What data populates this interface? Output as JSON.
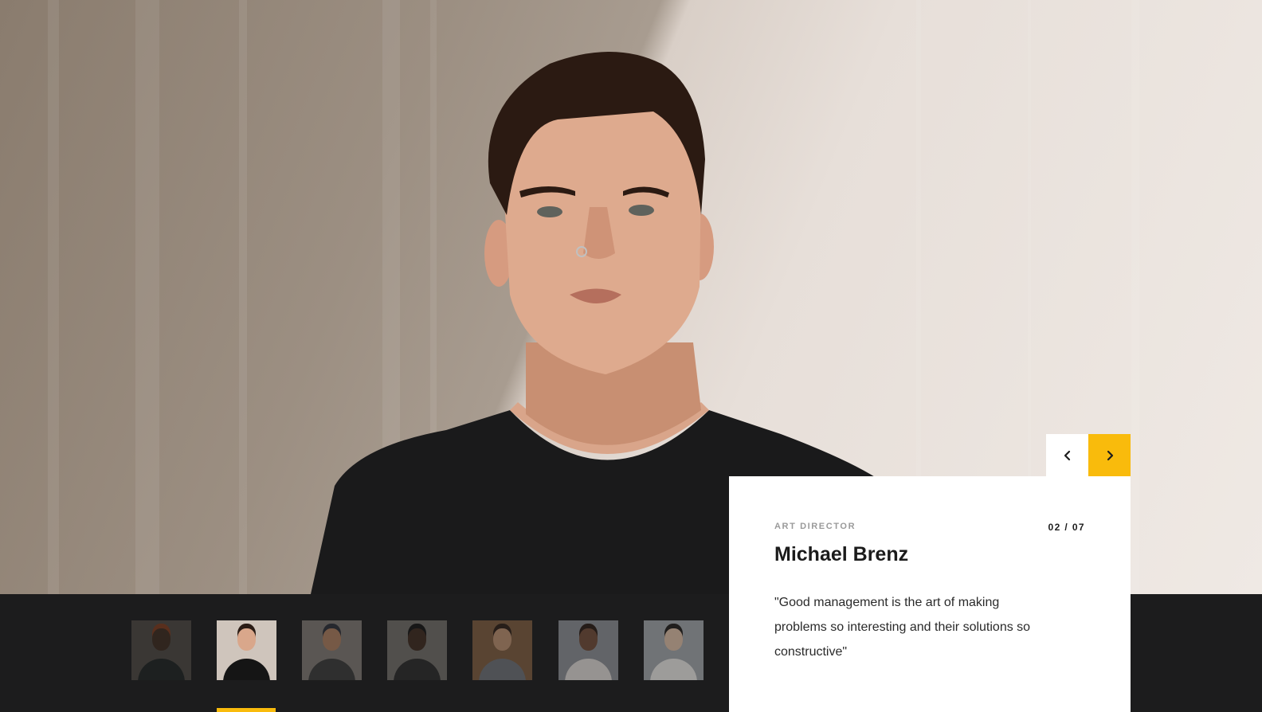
{
  "hero": {
    "image": "portrait-photo",
    "description_icon": "person-photo"
  },
  "card": {
    "role": "ART DIRECTOR",
    "counter": "02 / 07",
    "name": "Michael Brenz",
    "quote": "\"Good management is the art of making problems so interesting and their solutions so constructive\""
  },
  "navigation": {
    "prev_icon": "chevron-left-icon",
    "next_icon": "chevron-right-icon"
  },
  "thumbnails": [
    {
      "name": "thumb-1",
      "bg": "#4a4641",
      "skin": "#3b2a20",
      "shirt": "#1e2322",
      "hat": "#7a3a1e"
    },
    {
      "name": "thumb-2",
      "bg": "#cfc5bc",
      "skin": "#d9a78b",
      "shirt": "#151515",
      "hat": "#2a1c15"
    },
    {
      "name": "thumb-3",
      "bg": "#7c7670",
      "skin": "#a67a5c",
      "shirt": "#3a3a3a",
      "hat": "#2c2f38"
    },
    {
      "name": "thumb-4",
      "bg": "#6d6a66",
      "skin": "#3c2a20",
      "shirt": "#2a2a2a",
      "hat": "#141414"
    },
    {
      "name": "thumb-5",
      "bg": "#7a5a3e",
      "skin": "#b48a6c",
      "shirt": "#6b6e73",
      "hat": "#2d2018"
    },
    {
      "name": "thumb-6",
      "bg": "#878a91",
      "skin": "#6d4a38",
      "shirt": "#d8d3cf",
      "hat": "#2a1d16"
    },
    {
      "name": "thumb-7",
      "bg": "#9da1a7",
      "skin": "#d6b8a2",
      "shirt": "#e2e0de",
      "hat": "#23201e"
    }
  ],
  "active_index": 1,
  "colors": {
    "accent": "#f9bb0c",
    "strip": "#1c1c1d",
    "card": "#ffffff"
  }
}
